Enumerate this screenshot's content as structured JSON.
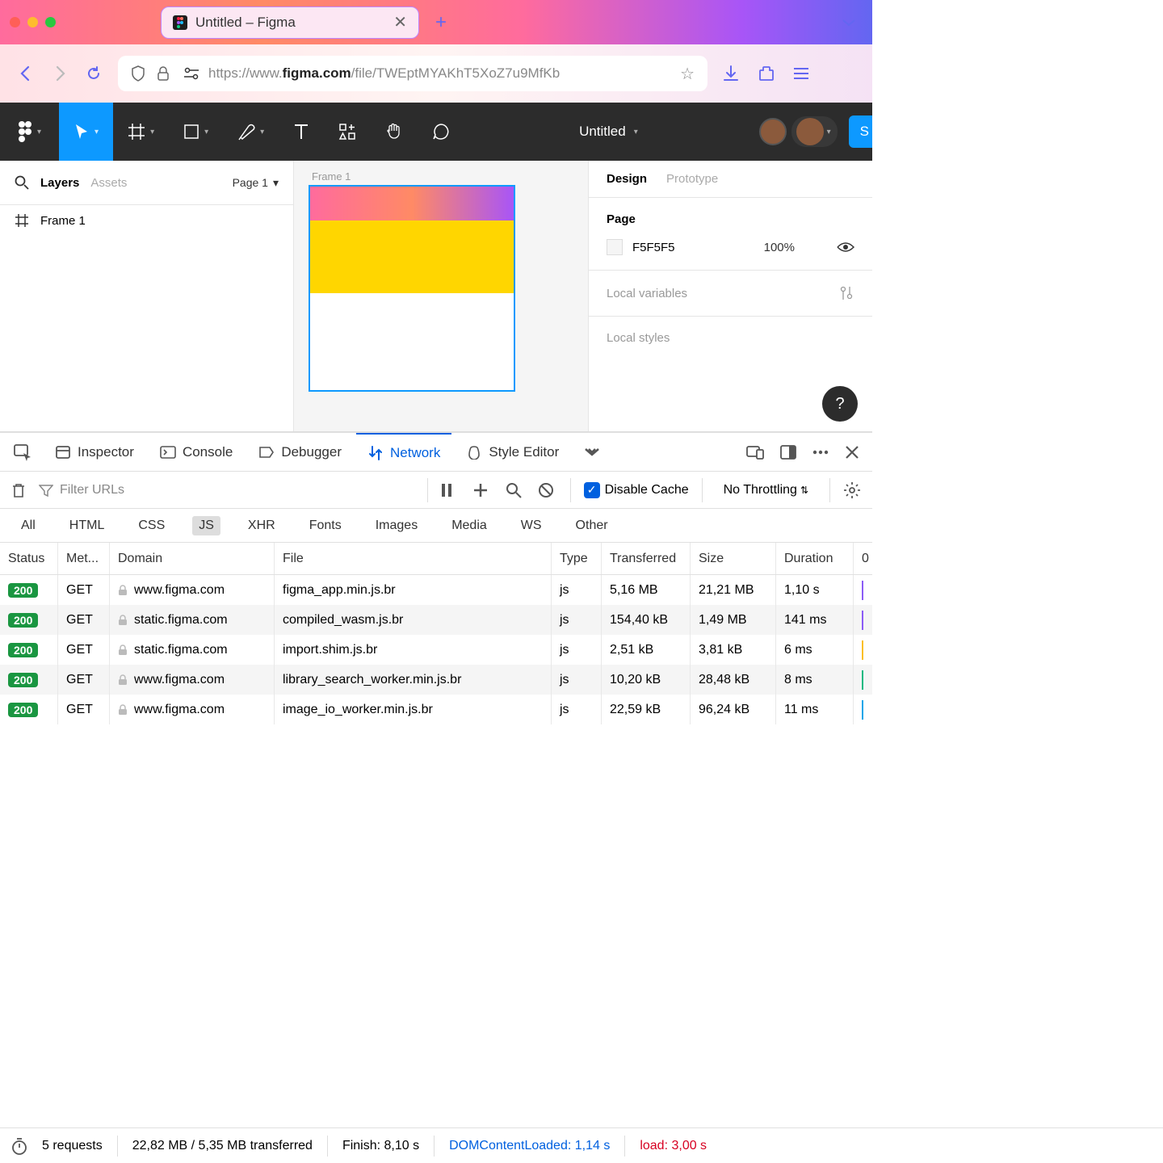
{
  "browser": {
    "tab_title": "Untitled – Figma",
    "url_prefix": "https://www.",
    "url_domain": "figma.com",
    "url_path": "/file/TWEptMYAKhT5XoZ7u9MfKb"
  },
  "figma": {
    "doc_title": "Untitled",
    "left": {
      "tab_layers": "Layers",
      "tab_assets": "Assets",
      "page_label": "Page 1",
      "item_0": "Frame 1"
    },
    "canvas": {
      "frame_label": "Frame 1"
    },
    "right": {
      "tab_design": "Design",
      "tab_prototype": "Prototype",
      "page_section": "Page",
      "bg_hex": "F5F5F5",
      "bg_opacity": "100%",
      "local_variables": "Local variables",
      "local_styles": "Local styles"
    }
  },
  "devtools": {
    "tabs": {
      "inspector": "Inspector",
      "console": "Console",
      "debugger": "Debugger",
      "network": "Network",
      "style_editor": "Style Editor"
    },
    "toolbar": {
      "filter_placeholder": "Filter URLs",
      "disable_cache": "Disable Cache",
      "throttling": "No Throttling"
    },
    "type_filters": {
      "all": "All",
      "html": "HTML",
      "css": "CSS",
      "js": "JS",
      "xhr": "XHR",
      "fonts": "Fonts",
      "images": "Images",
      "media": "Media",
      "ws": "WS",
      "other": "Other"
    },
    "columns": {
      "status": "Status",
      "method": "Met...",
      "domain": "Domain",
      "file": "File",
      "type": "Type",
      "transferred": "Transferred",
      "size": "Size",
      "duration": "Duration"
    },
    "rows": [
      {
        "status": "200",
        "method": "GET",
        "domain": "www.figma.com",
        "file": "figma_app.min.js.br",
        "type": "js",
        "transferred": "5,16 MB",
        "size": "21,21 MB",
        "duration": "1,10 s",
        "wf": "#8b5cf6"
      },
      {
        "status": "200",
        "method": "GET",
        "domain": "static.figma.com",
        "file": "compiled_wasm.js.br",
        "type": "js",
        "transferred": "154,40 kB",
        "size": "1,49 MB",
        "duration": "141 ms",
        "wf": "#8b5cf6"
      },
      {
        "status": "200",
        "method": "GET",
        "domain": "static.figma.com",
        "file": "import.shim.js.br",
        "type": "js",
        "transferred": "2,51 kB",
        "size": "3,81 kB",
        "duration": "6 ms",
        "wf": "#fbbf24"
      },
      {
        "status": "200",
        "method": "GET",
        "domain": "www.figma.com",
        "file": "library_search_worker.min.js.br",
        "type": "js",
        "transferred": "10,20 kB",
        "size": "28,48 kB",
        "duration": "8 ms",
        "wf": "#10b981"
      },
      {
        "status": "200",
        "method": "GET",
        "domain": "www.figma.com",
        "file": "image_io_worker.min.js.br",
        "type": "js",
        "transferred": "22,59 kB",
        "size": "96,24 kB",
        "duration": "11 ms",
        "wf": "#0ea5e9"
      }
    ],
    "status_bar": {
      "requests": "5 requests",
      "transferred": "22,82 MB / 5,35 MB transferred",
      "finish": "Finish: 8,10 s",
      "dcl": "DOMContentLoaded: 1,14 s",
      "load": "load: 3,00 s"
    }
  }
}
